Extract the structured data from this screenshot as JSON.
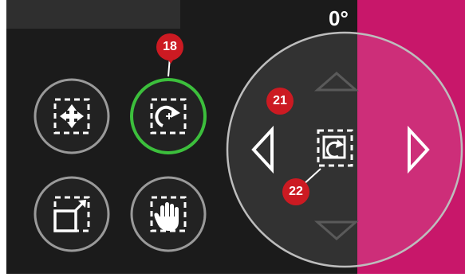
{
  "rotation": {
    "angle_label": "0°"
  },
  "callouts": {
    "callout_18": "18",
    "callout_21": "21",
    "callout_22": "22"
  },
  "buttons": {
    "move": "move-icon",
    "rotate": "rotate-icon",
    "resize": "resize-icon",
    "pan": "hand-icon"
  },
  "dial": {
    "center": "rotate-reset-icon",
    "up": "arrow-up-icon",
    "down": "arrow-down-icon",
    "left": "arrow-left-icon",
    "right": "arrow-right-icon"
  },
  "colors": {
    "background": "#1b1b1b",
    "accent": "#c8176a",
    "selected_ring": "#3cbf3c",
    "ring": "#9a9a9a",
    "callout": "#cc1a22"
  }
}
